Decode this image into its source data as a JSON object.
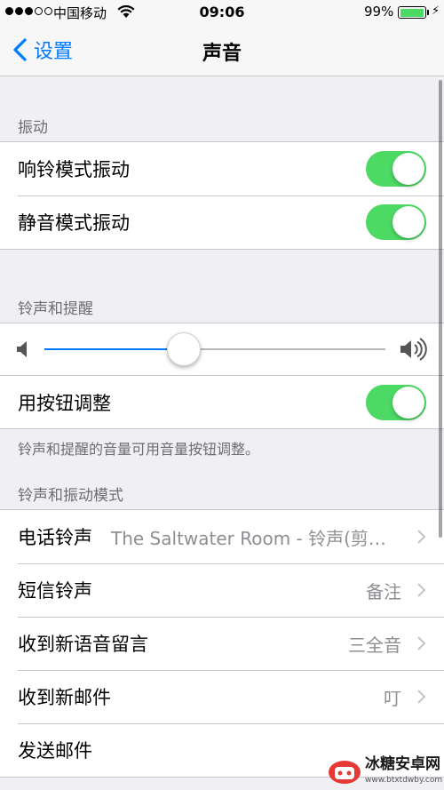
{
  "status_bar": {
    "carrier": "中国移动",
    "time": "09:06",
    "battery": "99%",
    "battery_level": 0.99,
    "signal_bars": 3
  },
  "nav": {
    "back_label": "设置",
    "title": "声音"
  },
  "vibrate": {
    "header": "振动",
    "items": [
      {
        "label": "响铃模式振动",
        "on": true
      },
      {
        "label": "静音模式振动",
        "on": true
      }
    ]
  },
  "ringer": {
    "header": "铃声和提醒",
    "volume_level": 0.41,
    "adjust_label": "用按钮调整",
    "adjust_on": true,
    "footer": "铃声和提醒的音量可用音量按钮调整。"
  },
  "sounds": {
    "header": "铃声和振动模式",
    "items": [
      {
        "label": "电话铃声",
        "value": "The Saltwater Room - 铃声(剪…"
      },
      {
        "label": "短信铃声",
        "value": "备注"
      },
      {
        "label": "收到新语音留言",
        "value": "三全音"
      },
      {
        "label": "收到新邮件",
        "value": "叮"
      },
      {
        "label": "发送邮件",
        "value": ""
      }
    ]
  },
  "watermark": {
    "name": "冰糖安卓网",
    "url": "www.btxtdwby.com"
  },
  "colors": {
    "accent": "#007aff",
    "toggle_on": "#4cd964",
    "background": "#efeff4"
  }
}
